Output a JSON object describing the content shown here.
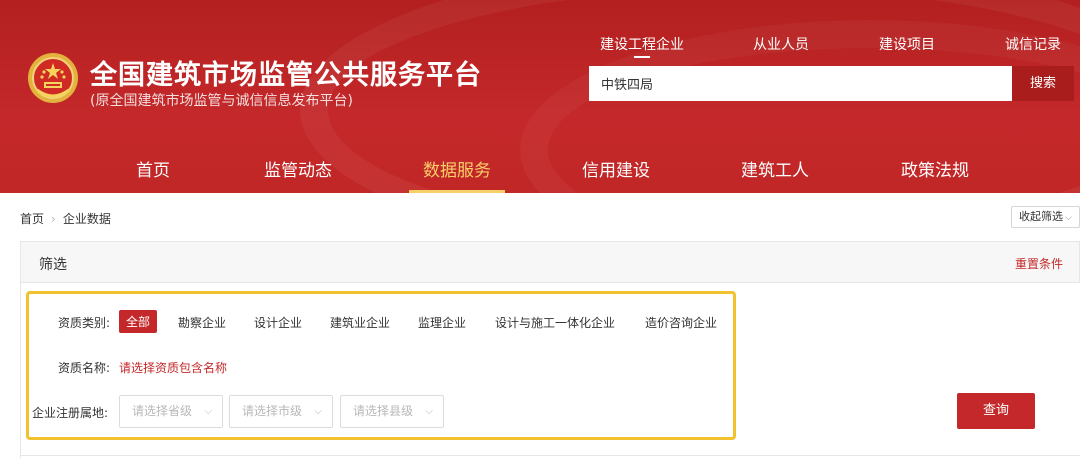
{
  "header": {
    "title": "全国建筑市场监管公共服务平台",
    "subtitle": "(原全国建筑市场监管与诚信信息发布平台)",
    "top_nav": [
      {
        "label": "建设工程企业",
        "active": true
      },
      {
        "label": "从业人员",
        "active": false
      },
      {
        "label": "建设项目",
        "active": false
      },
      {
        "label": "诚信记录",
        "active": false
      }
    ],
    "search": {
      "value": "中铁四局",
      "button_label": "搜索"
    },
    "main_nav": [
      {
        "label": "首页",
        "active": false
      },
      {
        "label": "监管动态",
        "active": false
      },
      {
        "label": "数据服务",
        "active": true
      },
      {
        "label": "信用建设",
        "active": false
      },
      {
        "label": "建筑工人",
        "active": false
      },
      {
        "label": "政策法规",
        "active": false
      }
    ],
    "colors": {
      "brand": "#c4282a",
      "nav_active": "#f7cf69"
    }
  },
  "breadcrumb": {
    "home": "首页",
    "current": "企业数据"
  },
  "collapse_label": "收起筛选",
  "filter": {
    "title": "筛选",
    "reset_label": "重置条件",
    "category_label": "资质类别:",
    "categories": [
      {
        "label": "全部",
        "active": true
      },
      {
        "label": "勘察企业",
        "active": false
      },
      {
        "label": "设计企业",
        "active": false
      },
      {
        "label": "建筑业企业",
        "active": false
      },
      {
        "label": "监理企业",
        "active": false
      },
      {
        "label": "设计与施工一体化企业",
        "active": false
      },
      {
        "label": "造价咨询企业",
        "active": false
      }
    ],
    "qualification_label": "资质名称:",
    "qualification_placeholder": "请选择资质包含名称",
    "region_label": "企业注册属地:",
    "region_selects": [
      {
        "placeholder": "请选择省级"
      },
      {
        "placeholder": "请选择市级"
      },
      {
        "placeholder": "请选择县级"
      }
    ],
    "query_label": "查询",
    "highlight_color": "#f2c12e"
  }
}
